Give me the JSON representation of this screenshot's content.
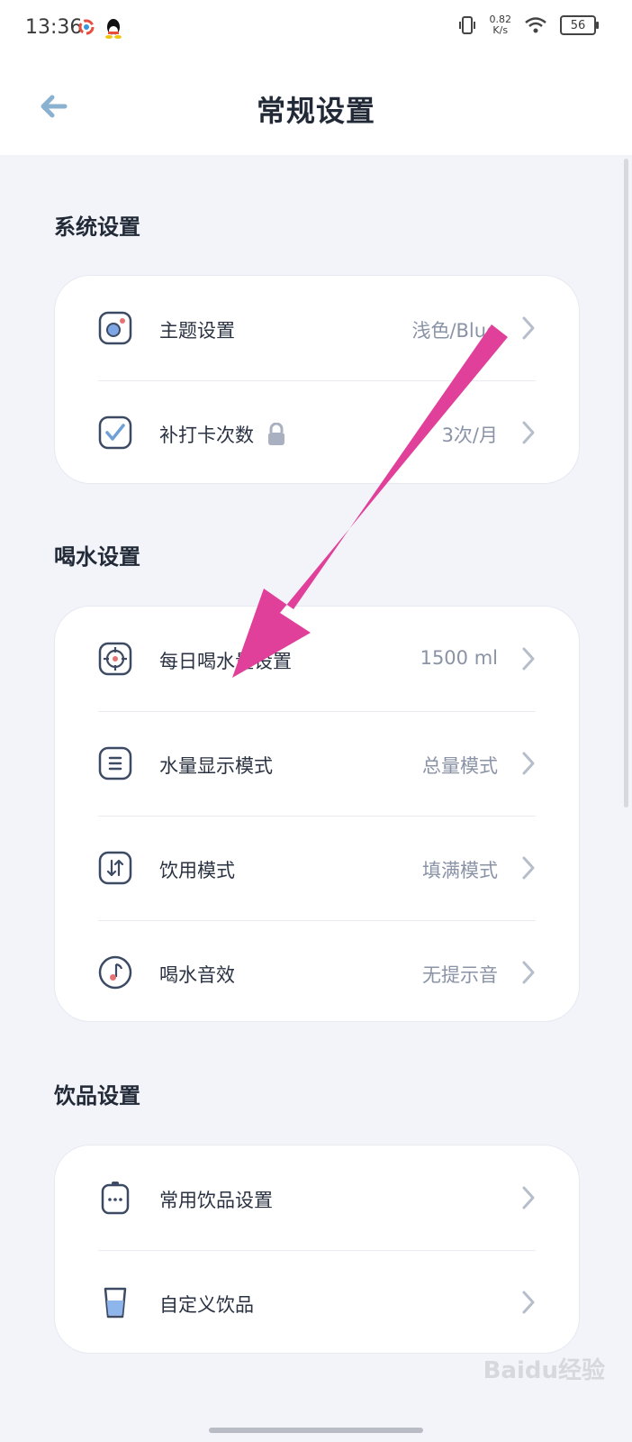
{
  "status_bar": {
    "time": "13:36",
    "net_speed_value": "0.82",
    "net_speed_unit": "K/s",
    "battery": "56"
  },
  "header": {
    "title": "常规设置",
    "back_icon": "arrow-left-icon"
  },
  "sections": {
    "system": {
      "title": "系统设置",
      "rows": [
        {
          "label": "主题设置",
          "value": "浅色/Blue",
          "icon": "theme-icon"
        },
        {
          "label": "补打卡次数",
          "value": "3次/月",
          "icon": "checkbox-icon",
          "badge_icon": "lock-icon"
        }
      ]
    },
    "water": {
      "title": "喝水设置",
      "rows": [
        {
          "label": "每日喝水量设置",
          "value": "1500 ml",
          "icon": "target-icon"
        },
        {
          "label": "水量显示模式",
          "value": "总量模式",
          "icon": "list-icon"
        },
        {
          "label": "饮用模式",
          "value": "填满模式",
          "icon": "swap-icon"
        },
        {
          "label": "喝水音效",
          "value": "无提示音",
          "icon": "music-note-icon"
        }
      ]
    },
    "drinks": {
      "title": "饮品设置",
      "rows": [
        {
          "label": "常用饮品设置",
          "value": "",
          "icon": "bottle-icon"
        },
        {
          "label": "自定义饮品",
          "value": "",
          "icon": "cup-icon"
        }
      ]
    }
  },
  "colors": {
    "accent": "#5b8fd8",
    "annotation_arrow": "#e0409a",
    "background": "#f2f4f9"
  },
  "watermark": "Baidu经验"
}
